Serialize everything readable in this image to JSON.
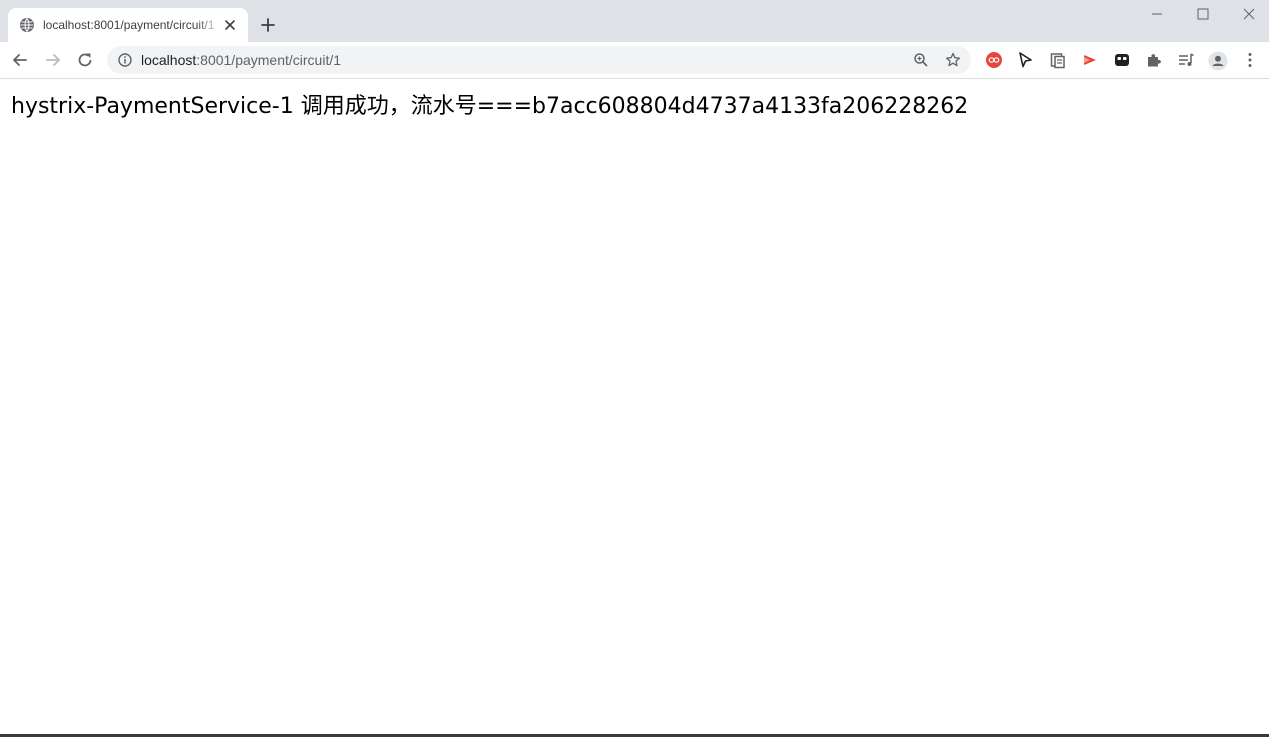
{
  "tab": {
    "title": "localhost:8001/payment/circuit/1",
    "favicon": "globe-icon"
  },
  "toolbar": {
    "url_host": "localhost",
    "url_path": ":8001/payment/circuit/1"
  },
  "page": {
    "message": "hystrix-PaymentService-1 调用成功，流水号===b7acc608804d4737a4133fa206228262"
  },
  "icons": {
    "back": "arrow-left-icon",
    "forward": "arrow-right-icon",
    "reload": "reload-icon",
    "info": "info-icon",
    "zoom": "zoom-icon",
    "bookmark": "star-icon",
    "extensions": [
      "extension-red-icon",
      "cursor-icon",
      "clipboard-icon",
      "play-icon",
      "mask-icon",
      "puzzle-icon",
      "reading-list-icon"
    ],
    "profile": "profile-icon",
    "menu": "kebab-menu-icon"
  },
  "colors": {
    "tabstrip": "#dee1e6",
    "omnibox": "#f1f3f4",
    "icon": "#5f6368",
    "accent_red": "#e8453c"
  }
}
